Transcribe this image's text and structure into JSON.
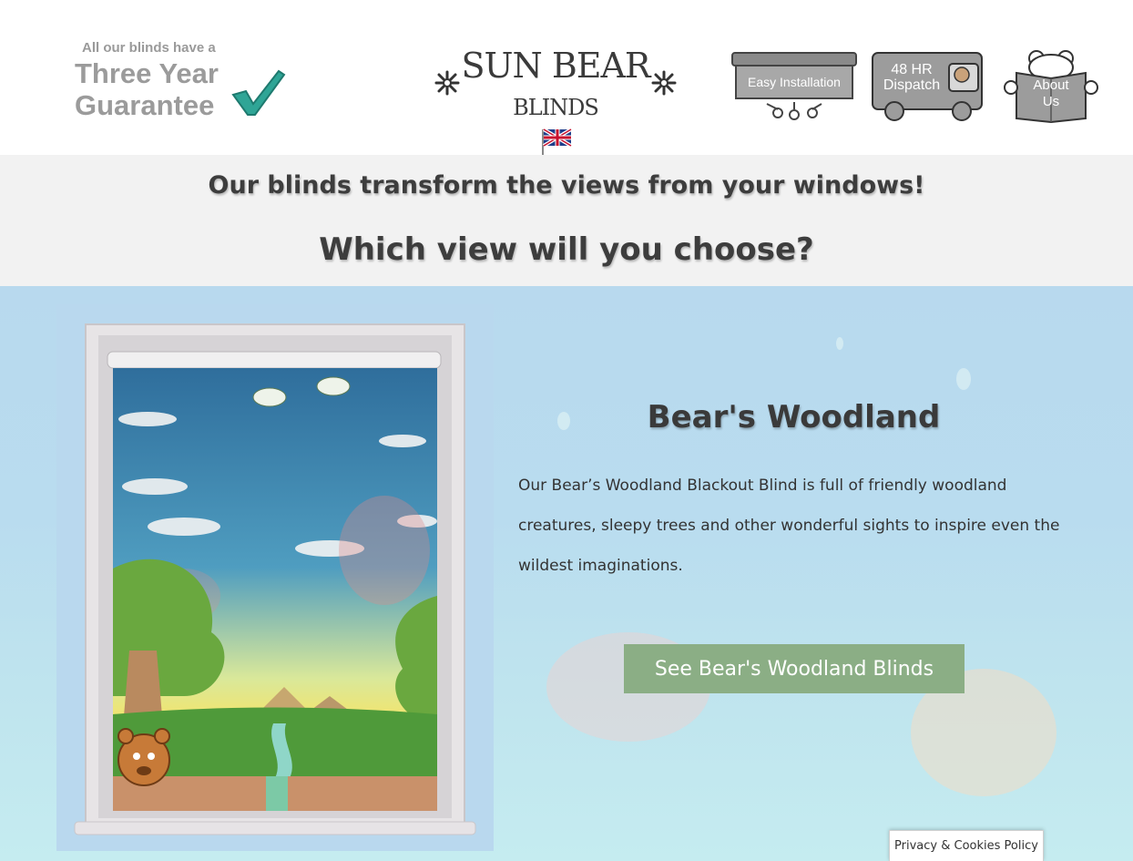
{
  "header": {
    "guarantee": {
      "small_text": "All our blinds have a",
      "line1": "Three Year",
      "line2": "Guarantee",
      "icon": "checkmark-icon"
    },
    "logo": {
      "brand": "SUN BEAR",
      "sub": "BLINDS",
      "icon": "star-icon"
    },
    "flag_icon": "uk-flag-icon",
    "badges": {
      "install": "Easy Installation",
      "dispatch_line1": "48 HR",
      "dispatch_line2": "Dispatch",
      "about_line1": "About",
      "about_line2": "Us"
    }
  },
  "band": {
    "line1": "Our blinds transform the views from your windows!",
    "line2": "Which view will you choose?"
  },
  "product": {
    "title": "Bear's Woodland",
    "description": "Our Bear’s Woodland Blackout Blind is full of friendly woodland creatures, sleepy trees and other wonderful sights to inspire even the wildest imaginations.",
    "cta_label": "See Bear's Woodland Blinds"
  },
  "footer": {
    "privacy_label": "Privacy & Cookies Policy"
  },
  "colors": {
    "cta_bg": "#8bae85",
    "band_bg": "#f2f2f2",
    "hero_bg": "#b9dcef"
  }
}
